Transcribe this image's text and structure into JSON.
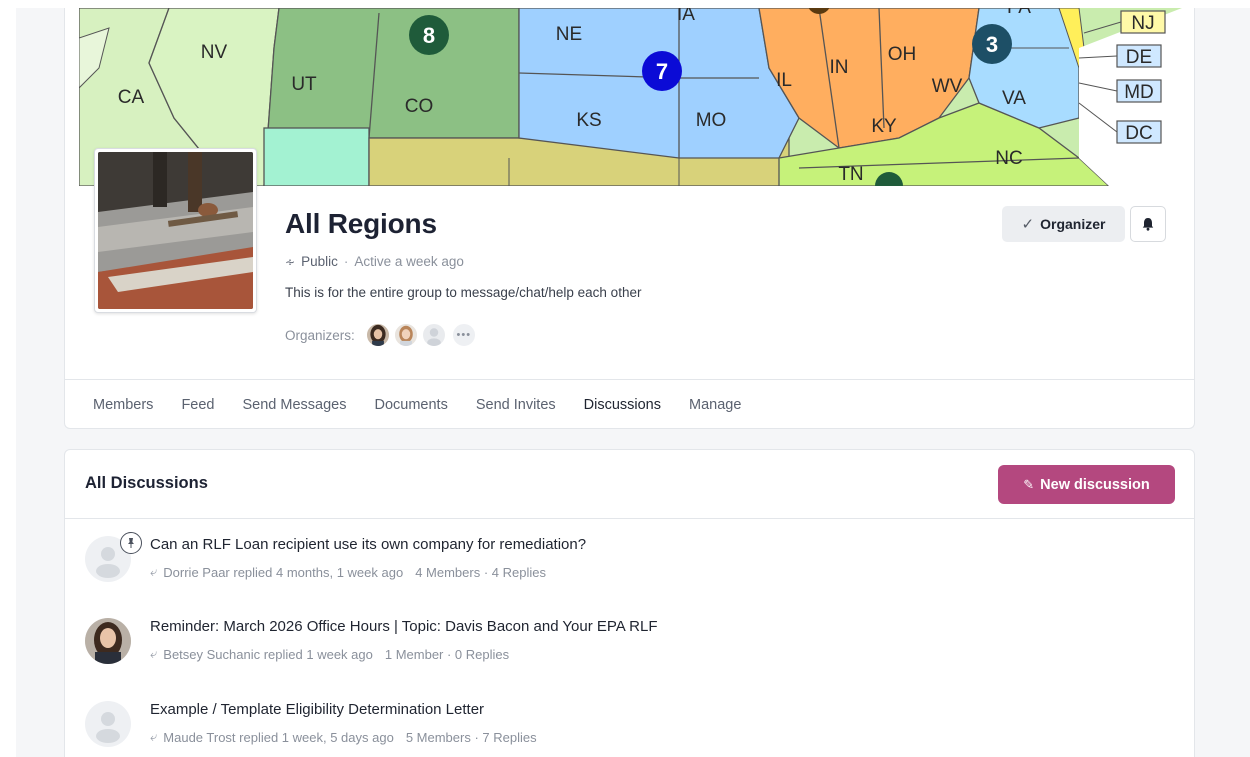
{
  "group": {
    "title": "All Regions",
    "visibility": "Public",
    "activity": "Active a week ago",
    "description": "This is for the entire group to message/chat/help each other",
    "organizers_label": "Organizers:",
    "organizer_button": "Organizer",
    "more_organizers": "•••"
  },
  "cover_map": {
    "labels": [
      "NV",
      "CA",
      "UT",
      "CO",
      "NE",
      "IA",
      "KS",
      "MO",
      "IL",
      "IN",
      "OH",
      "PA",
      "WV",
      "VA",
      "KY",
      "TN",
      "NC",
      "NJ",
      "DE",
      "MD",
      "DC"
    ],
    "regions": [
      "8",
      "7",
      "3"
    ]
  },
  "tabs": [
    "Members",
    "Feed",
    "Send Messages",
    "Documents",
    "Send Invites",
    "Discussions",
    "Manage"
  ],
  "active_tab": "Discussions",
  "discussions": {
    "heading": "All Discussions",
    "new_button": "New discussion",
    "items": [
      {
        "title": "Can an RLF Loan recipient use its own company for remediation?",
        "replied": "Dorrie Paar replied 4 months, 1 week ago",
        "stats": "4 Members · 4 Replies",
        "pinned": true
      },
      {
        "title": "Reminder: March 2026 Office Hours | Topic: Davis Bacon and Your EPA RLF",
        "replied": "Betsey Suchanic replied 1 week ago",
        "stats": "1 Member · 0 Replies",
        "pinned": false
      },
      {
        "title": "Example / Template Eligibility Determination Letter",
        "replied": "Maude Trost replied 1 week, 5 days ago",
        "stats": "5 Members · 7 Replies",
        "pinned": false
      }
    ]
  },
  "colors": {
    "accent_button": "#b4487f",
    "active_tab_underline": "#3c6df0"
  }
}
